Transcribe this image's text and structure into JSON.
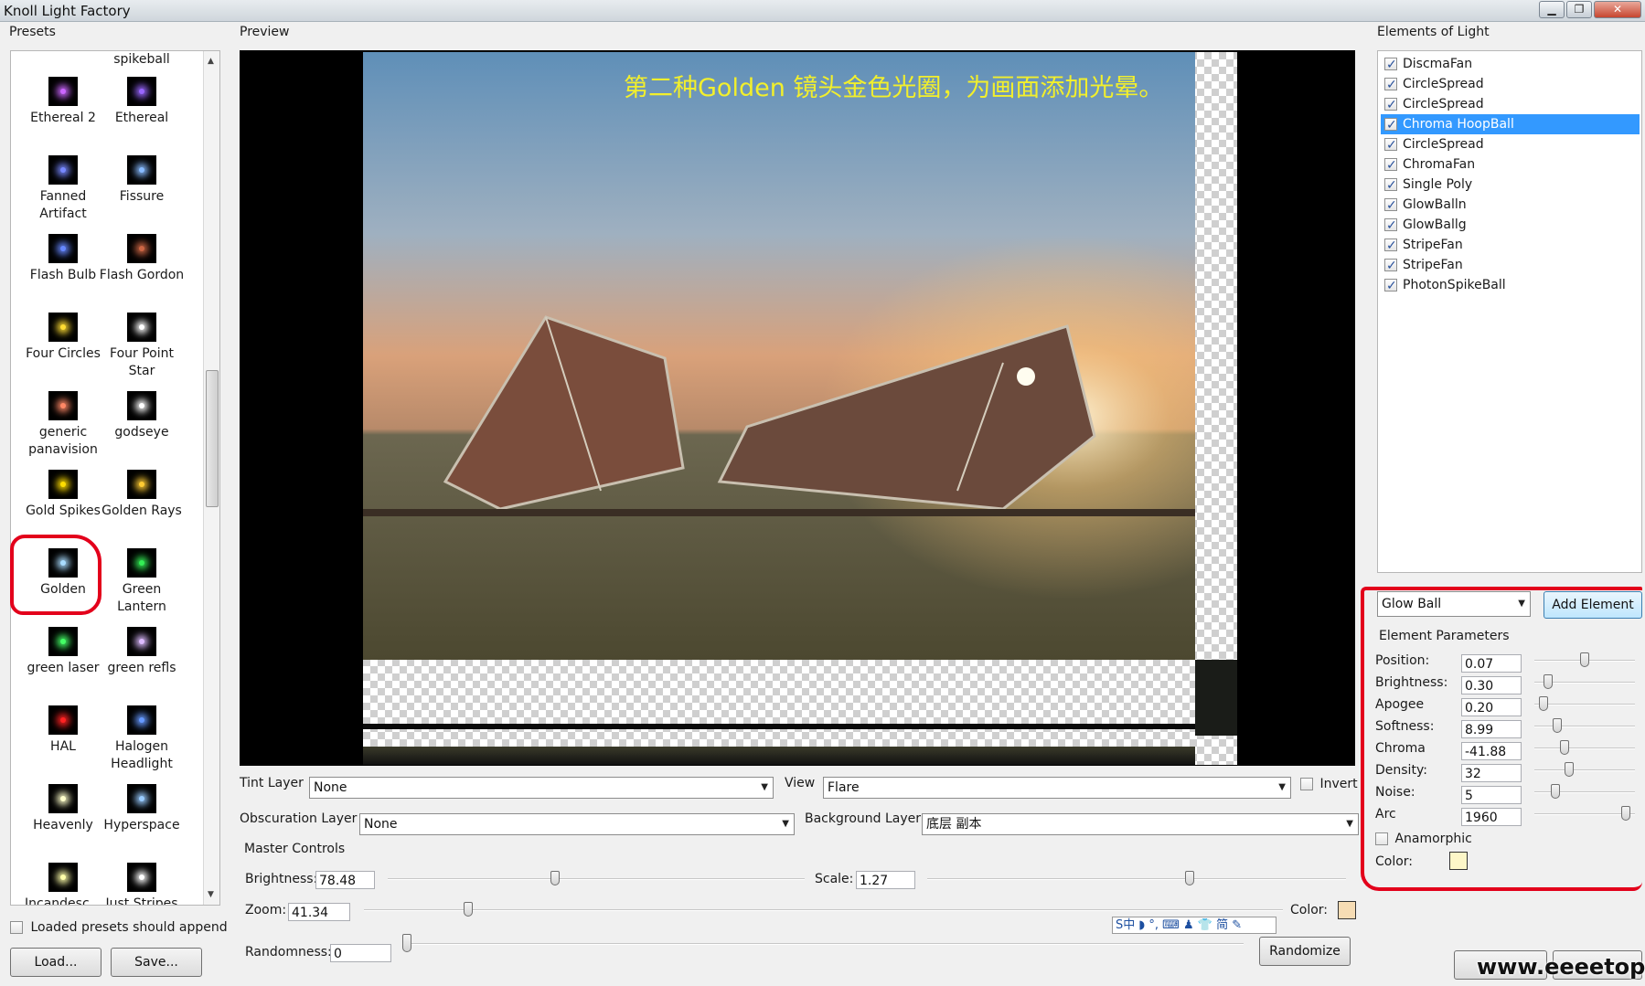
{
  "window": {
    "title": "Knoll Light Factory"
  },
  "sections": {
    "presets": "Presets",
    "preview": "Preview",
    "elements": "Elements of Light",
    "master": "Master Controls",
    "element_params": "Element Parameters"
  },
  "presets": {
    "top_label": "spikeball",
    "items": [
      {
        "label": "Ethereal 2",
        "color": "#cc66ff"
      },
      {
        "label": "Ethereal",
        "color": "#9966ff"
      },
      {
        "label": "Fanned Artifact",
        "color": "#7788ff"
      },
      {
        "label": "Fissure",
        "color": "#88bbff"
      },
      {
        "label": "Flash Bulb",
        "color": "#6688ff"
      },
      {
        "label": "Flash Gordon",
        "color": "#cc6644"
      },
      {
        "label": "Four Circles",
        "color": "#ffdd33"
      },
      {
        "label": "Four Point Star",
        "color": "#ffffff"
      },
      {
        "label": "generic panavision",
        "color": "#ff8866"
      },
      {
        "label": "godseye",
        "color": "#ffffff"
      },
      {
        "label": "Gold Spikes",
        "color": "#ffdd00"
      },
      {
        "label": "Golden Rays",
        "color": "#ffcc33"
      },
      {
        "label": "Golden",
        "color": "#aaddff"
      },
      {
        "label": "Green Lantern",
        "color": "#33ee55"
      },
      {
        "label": "green laser",
        "color": "#44ff66"
      },
      {
        "label": "green refls",
        "color": "#ddbbff"
      },
      {
        "label": "HAL",
        "color": "#ff2222"
      },
      {
        "label": "Halogen Headlight",
        "color": "#6699ff"
      },
      {
        "label": "Heavenly",
        "color": "#ffffcc"
      },
      {
        "label": "Hyperspace",
        "color": "#99ccff"
      },
      {
        "label": "Incandesc...",
        "color": "#ffffaa"
      },
      {
        "label": "Just Stripes",
        "color": "#ffffff"
      }
    ],
    "append_label": "Loaded presets should append",
    "load_label": "Load...",
    "save_label": "Save..."
  },
  "preview": {
    "caption": "第二种Golden 镜头金色光圈，为画面添加光晕。"
  },
  "layers": {
    "tint_label": "Tint Layer",
    "tint_value": "None",
    "view_label": "View",
    "view_value": "Flare",
    "invert_label": "Invert",
    "obscuration_label": "Obscuration Layer",
    "obscuration_value": "None",
    "background_label": "Background Layer",
    "background_value": "底层 副本"
  },
  "master": {
    "brightness_label": "Brightness:",
    "brightness_value": "78.48",
    "brightness_level": 0.4,
    "scale_label": "Scale:",
    "scale_value": "1.27",
    "scale_level": 0.63,
    "zoom_label": "Zoom:",
    "zoom_value": "41.34",
    "zoom_level": 0.11,
    "color_label": "Color:",
    "color_value": "#f6dcb4",
    "randomness_label": "Randomness:",
    "randomness_value": "0",
    "randomness_level": 0.0,
    "randomize_label": "Randomize"
  },
  "elements": {
    "items": [
      {
        "label": "DiscmaFan",
        "checked": true,
        "selected": false
      },
      {
        "label": "CircleSpread",
        "checked": true,
        "selected": false
      },
      {
        "label": "CircleSpread",
        "checked": true,
        "selected": false
      },
      {
        "label": "Chroma HoopBall",
        "checked": true,
        "selected": true
      },
      {
        "label": "CircleSpread",
        "checked": true,
        "selected": false
      },
      {
        "label": "ChromaFan",
        "checked": true,
        "selected": false
      },
      {
        "label": "Single Poly",
        "checked": true,
        "selected": false
      },
      {
        "label": "GlowBalln",
        "checked": true,
        "selected": false
      },
      {
        "label": "GlowBallg",
        "checked": true,
        "selected": false
      },
      {
        "label": "StripeFan",
        "checked": true,
        "selected": false
      },
      {
        "label": "StripeFan",
        "checked": true,
        "selected": false
      },
      {
        "label": "PhotonSpikeBall",
        "checked": true,
        "selected": false
      }
    ],
    "type_value": "Glow Ball",
    "add_label": "Add Element"
  },
  "params": {
    "items": [
      {
        "label": "Position:",
        "value": "0.07",
        "level": 0.5
      },
      {
        "label": "Brightness:",
        "value": "0.30",
        "level": 0.1
      },
      {
        "label": "Apogee",
        "value": "0.20",
        "level": 0.05
      },
      {
        "label": "Softness:",
        "value": "8.99",
        "level": 0.2
      },
      {
        "label": "Chroma",
        "value": "-41.88",
        "level": 0.28
      },
      {
        "label": "Density:",
        "value": "32",
        "level": 0.33
      },
      {
        "label": "Noise:",
        "value": "5",
        "level": 0.18
      },
      {
        "label": "Arc",
        "value": "1960",
        "level": 0.95
      }
    ],
    "anamorphic_label": "Anamorphic",
    "color_label": "Color:",
    "color_value": "#fdf7c8"
  },
  "ime": {
    "text": "S中 ◗ °, ⌨ ♟ 👕 简 ✎"
  },
  "watermark": "www.eeeetop.com"
}
